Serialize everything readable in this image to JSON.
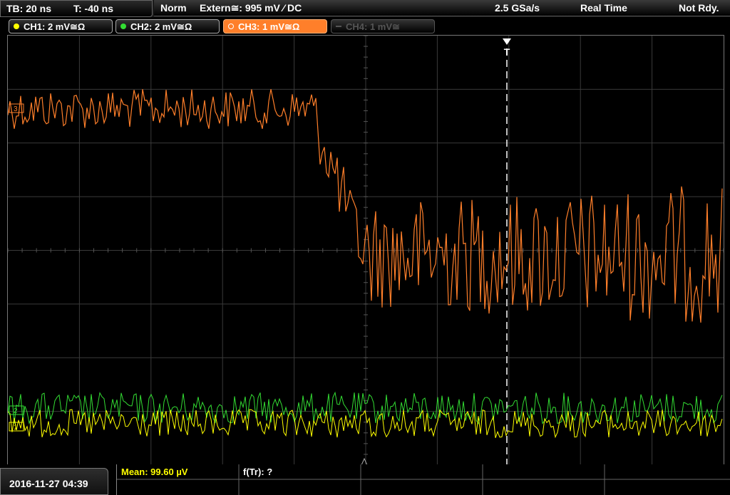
{
  "header": {
    "timebase": "TB: 20 ns",
    "trigger_time": "T: -40 ns",
    "trigger_mode": "Norm",
    "trigger_source": "Extern≅: 995 mV ⁄ DC",
    "sample_rate": "2.5 GSa/s",
    "acq_mode": "Real Time",
    "status": "Not Rdy."
  },
  "channels": [
    {
      "label": "CH1: 2 mV≅Ω",
      "color": "#ffff00",
      "state": "on"
    },
    {
      "label": "CH2: 2 mV≅Ω",
      "color": "#33dd33",
      "state": "on"
    },
    {
      "label": "CH3: 1 mV≅Ω",
      "color": "#ff7f2a",
      "state": "active"
    },
    {
      "label": "CH4: 1 mV≅",
      "color": "#666666",
      "state": "off"
    }
  ],
  "markers": {
    "ch1": "1",
    "ch2": "2",
    "ch3": "3",
    "trigger": "T"
  },
  "footer": {
    "datetime": "2016-11-27 04:39",
    "measurement_1": "Mean: 99.60 µV",
    "measurement_2": "f(Tr): ?"
  },
  "colors": {
    "ch1": "#ffff00",
    "ch2": "#33dd33",
    "ch3": "#ff7f2a",
    "grid": "#3a3a3a",
    "meas_label": "#ffff00"
  }
}
